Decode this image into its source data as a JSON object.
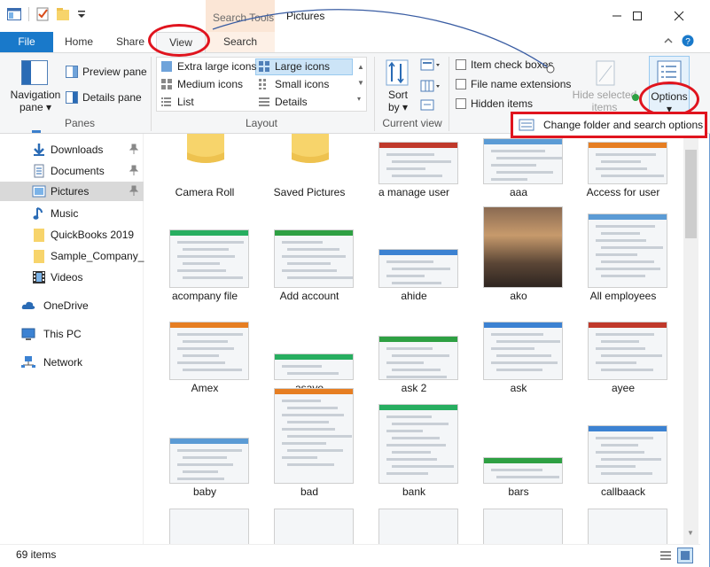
{
  "window": {
    "title": "Pictures",
    "context_tab_group": "Search Tools"
  },
  "tabs": {
    "file": "File",
    "home": "Home",
    "share": "Share",
    "view": "View",
    "search": "Search"
  },
  "ribbon": {
    "panes": {
      "navigation_pane": "Navigation",
      "navigation_pane2": "pane",
      "preview_pane": "Preview pane",
      "details_pane": "Details pane",
      "label": "Panes"
    },
    "layout": {
      "extra_large": "Extra large icons",
      "large": "Large icons",
      "medium": "Medium icons",
      "small": "Small icons",
      "list": "List",
      "details": "Details",
      "label": "Layout"
    },
    "current_view": {
      "sort_by": "Sort",
      "sort_by2": "by",
      "label": "Current view"
    },
    "show_hide": {
      "item_check_boxes": "Item check boxes",
      "file_name_extensions": "File name extensions",
      "hidden_items": "Hidden items",
      "hide_selected": "Hide selected",
      "hide_selected2": "items"
    },
    "options": {
      "label": "Options"
    }
  },
  "popup": {
    "change_folder_options": "Change folder and search options"
  },
  "sidebar": {
    "items": [
      {
        "label": "Downloads",
        "icon": "download-icon",
        "pinned": true
      },
      {
        "label": "Documents",
        "icon": "documents-icon",
        "pinned": true
      },
      {
        "label": "Pictures",
        "icon": "pictures-icon",
        "pinned": true
      },
      {
        "label": "Music",
        "icon": "music-icon"
      },
      {
        "label": "QuickBooks 2019",
        "icon": "folder-icon"
      },
      {
        "label": "Sample_Company_I",
        "icon": "folder-icon"
      },
      {
        "label": "Videos",
        "icon": "videos-icon"
      },
      {
        "label": "OneDrive",
        "icon": "cloud-icon"
      },
      {
        "label": "This PC",
        "icon": "computer-icon"
      },
      {
        "label": "Network",
        "icon": "network-icon"
      }
    ]
  },
  "files": [
    {
      "name": "Camera Roll",
      "kind": "folder"
    },
    {
      "name": "Saved Pictures",
      "kind": "folder"
    },
    {
      "name": "a manage user",
      "kind": "image"
    },
    {
      "name": "aaa",
      "kind": "image"
    },
    {
      "name": "Access for user",
      "kind": "image"
    },
    {
      "name": "acompany file",
      "kind": "image"
    },
    {
      "name": "Add account",
      "kind": "image"
    },
    {
      "name": "ahide",
      "kind": "image"
    },
    {
      "name": "ako",
      "kind": "photo"
    },
    {
      "name": "All employees",
      "kind": "image"
    },
    {
      "name": "Amex",
      "kind": "image"
    },
    {
      "name": "asave",
      "kind": "image"
    },
    {
      "name": "ask 2",
      "kind": "image"
    },
    {
      "name": "ask",
      "kind": "image"
    },
    {
      "name": "ayee",
      "kind": "image"
    },
    {
      "name": "baby",
      "kind": "image"
    },
    {
      "name": "bad",
      "kind": "image"
    },
    {
      "name": "bank",
      "kind": "image"
    },
    {
      "name": "bars",
      "kind": "image"
    },
    {
      "name": "callbaack",
      "kind": "image"
    }
  ],
  "status": {
    "item_count": "69 items"
  },
  "colors": {
    "accent": "#1979ca",
    "annotation_red": "#e0141e",
    "selection": "#cce4f7"
  }
}
